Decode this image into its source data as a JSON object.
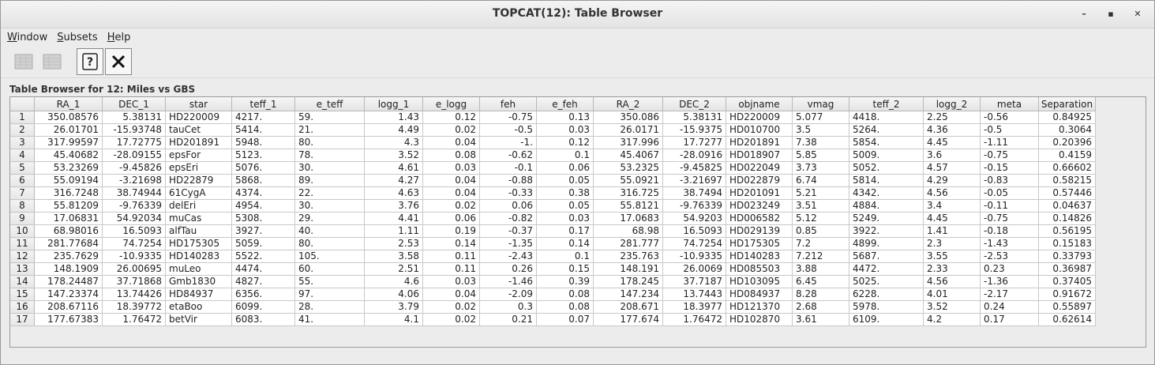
{
  "window": {
    "title": "TOPCAT(12): Table Browser"
  },
  "menu": [
    "Window",
    "Subsets",
    "Help"
  ],
  "label": "Table Browser for 12: Miles vs GBS",
  "columns": [
    "RA_1",
    "DEC_1",
    "star",
    "teff_1",
    "e_teff",
    "logg_1",
    "e_logg",
    "feh",
    "e_feh",
    "RA_2",
    "DEC_2",
    "objname",
    "vmag",
    "teff_2",
    "logg_2",
    "meta",
    "Separation"
  ],
  "align": [
    "r",
    "r",
    "l",
    "l",
    "l",
    "r",
    "r",
    "r",
    "r",
    "r",
    "r",
    "l",
    "l",
    "l",
    "l",
    "l",
    "r"
  ],
  "widths": [
    86,
    80,
    84,
    80,
    88,
    74,
    72,
    72,
    72,
    88,
    80,
    84,
    72,
    94,
    72,
    74,
    72
  ],
  "rows": [
    [
      "1",
      "350.08576",
      "5.38131",
      "HD220009",
      "4217.",
      "59.",
      "1.43",
      "0.12",
      "-0.75",
      "0.13",
      "350.086",
      "5.38131",
      "HD220009",
      "5.077",
      "4418.",
      "2.25",
      "-0.56",
      "0.84925"
    ],
    [
      "2",
      "26.01701",
      "-15.93748",
      "tauCet",
      "5414.",
      "21.",
      "4.49",
      "0.02",
      "-0.5",
      "0.03",
      "26.0171",
      "-15.9375",
      "HD010700",
      "3.5",
      "5264.",
      "4.36",
      "-0.5",
      "0.3064"
    ],
    [
      "3",
      "317.99597",
      "17.72775",
      "HD201891",
      "5948.",
      "80.",
      "4.3",
      "0.04",
      "-1.",
      "0.12",
      "317.996",
      "17.7277",
      "HD201891",
      "7.38",
      "5854.",
      "4.45",
      "-1.11",
      "0.20396"
    ],
    [
      "4",
      "45.40682",
      "-28.09155",
      "epsFor",
      "5123.",
      "78.",
      "3.52",
      "0.08",
      "-0.62",
      "0.1",
      "45.4067",
      "-28.0916",
      "HD018907",
      "5.85",
      "5009.",
      "3.6",
      "-0.75",
      "0.4159"
    ],
    [
      "5",
      "53.23269",
      "-9.45826",
      "epsEri",
      "5076.",
      "30.",
      "4.61",
      "0.03",
      "-0.1",
      "0.06",
      "53.2325",
      "-9.45825",
      "HD022049",
      "3.73",
      "5052.",
      "4.57",
      "-0.15",
      "0.66602"
    ],
    [
      "6",
      "55.09194",
      "-3.21698",
      "HD22879",
      "5868.",
      "89.",
      "4.27",
      "0.04",
      "-0.88",
      "0.05",
      "55.0921",
      "-3.21697",
      "HD022879",
      "6.74",
      "5814.",
      "4.29",
      "-0.83",
      "0.58215"
    ],
    [
      "7",
      "316.7248",
      "38.74944",
      "61CygA",
      "4374.",
      "22.",
      "4.63",
      "0.04",
      "-0.33",
      "0.38",
      "316.725",
      "38.7494",
      "HD201091",
      "5.21",
      "4342.",
      "4.56",
      "-0.05",
      "0.57446"
    ],
    [
      "8",
      "55.81209",
      "-9.76339",
      "delEri",
      "4954.",
      "30.",
      "3.76",
      "0.02",
      "0.06",
      "0.05",
      "55.8121",
      "-9.76339",
      "HD023249",
      "3.51",
      "4884.",
      "3.4",
      "-0.11",
      "0.04637"
    ],
    [
      "9",
      "17.06831",
      "54.92034",
      "muCas",
      "5308.",
      "29.",
      "4.41",
      "0.06",
      "-0.82",
      "0.03",
      "17.0683",
      "54.9203",
      "HD006582",
      "5.12",
      "5249.",
      "4.45",
      "-0.75",
      "0.14826"
    ],
    [
      "10",
      "68.98016",
      "16.5093",
      "alfTau",
      "3927.",
      "40.",
      "1.11",
      "0.19",
      "-0.37",
      "0.17",
      "68.98",
      "16.5093",
      "HD029139",
      "0.85",
      "3922.",
      "1.41",
      "-0.18",
      "0.56195"
    ],
    [
      "11",
      "281.77684",
      "74.7254",
      "HD175305",
      "5059.",
      "80.",
      "2.53",
      "0.14",
      "-1.35",
      "0.14",
      "281.777",
      "74.7254",
      "HD175305",
      "7.2",
      "4899.",
      "2.3",
      "-1.43",
      "0.15183"
    ],
    [
      "12",
      "235.7629",
      "-10.9335",
      "HD140283",
      "5522.",
      "105.",
      "3.58",
      "0.11",
      "-2.43",
      "0.1",
      "235.763",
      "-10.9335",
      "HD140283",
      "7.212",
      "5687.",
      "3.55",
      "-2.53",
      "0.33793"
    ],
    [
      "13",
      "148.1909",
      "26.00695",
      "muLeo",
      "4474.",
      "60.",
      "2.51",
      "0.11",
      "0.26",
      "0.15",
      "148.191",
      "26.0069",
      "HD085503",
      "3.88",
      "4472.",
      "2.33",
      "0.23",
      "0.36987"
    ],
    [
      "14",
      "178.24487",
      "37.71868",
      "Gmb1830",
      "4827.",
      "55.",
      "4.6",
      "0.03",
      "-1.46",
      "0.39",
      "178.245",
      "37.7187",
      "HD103095",
      "6.45",
      "5025.",
      "4.56",
      "-1.36",
      "0.37405"
    ],
    [
      "15",
      "147.23374",
      "13.74426",
      "HD84937",
      "6356.",
      "97.",
      "4.06",
      "0.04",
      "-2.09",
      "0.08",
      "147.234",
      "13.7443",
      "HD084937",
      "8.28",
      "6228.",
      "4.01",
      "-2.17",
      "0.91672"
    ],
    [
      "16",
      "208.67116",
      "18.39772",
      "etaBoo",
      "6099.",
      "28.",
      "3.79",
      "0.02",
      "0.3",
      "0.08",
      "208.671",
      "18.3977",
      "HD121370",
      "2.68",
      "5978.",
      "3.52",
      "0.24",
      "0.55897"
    ],
    [
      "17",
      "177.67383",
      "1.76472",
      "betVir",
      "6083.",
      "41.",
      "4.1",
      "0.02",
      "0.21",
      "0.07",
      "177.674",
      "1.76472",
      "HD102870",
      "3.61",
      "6109.",
      "4.2",
      "0.17",
      "0.62614"
    ]
  ]
}
